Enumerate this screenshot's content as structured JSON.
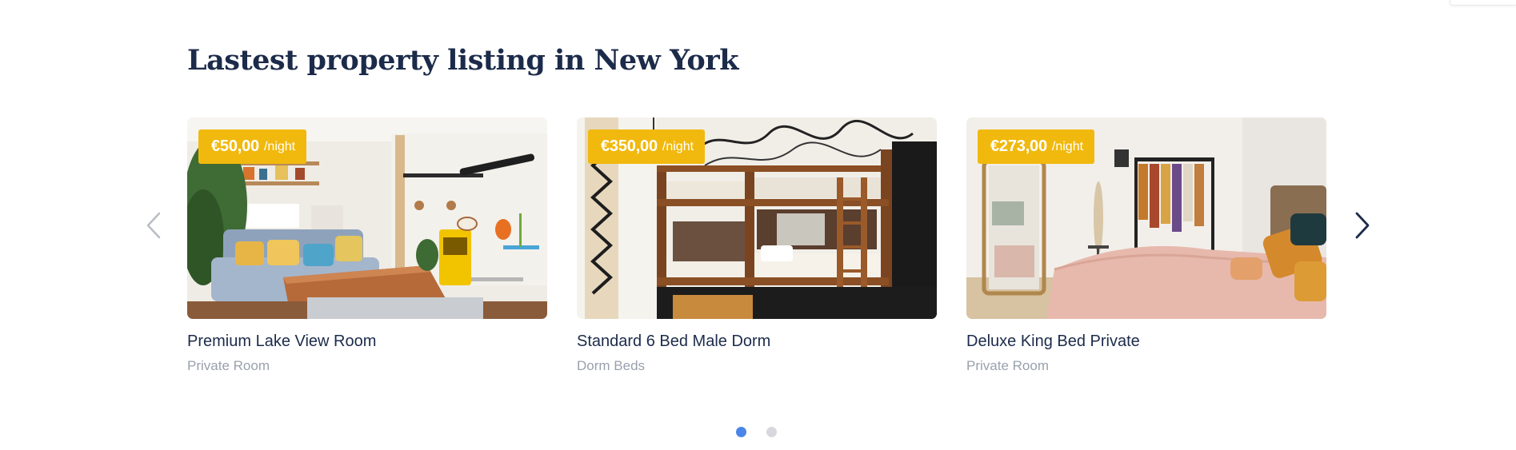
{
  "section": {
    "title": "Lastest property listing in New York"
  },
  "carousel": {
    "prev_icon": "chevron-left-icon",
    "next_icon": "chevron-right-icon",
    "listings": [
      {
        "price": "€50,00",
        "price_unit": "/night",
        "title": "Premium Lake View Room",
        "type": "Private Room",
        "image": "living-room-photo"
      },
      {
        "price": "€350,00",
        "price_unit": "/night",
        "title": "Standard 6 Bed Male Dorm",
        "type": "Dorm Beds",
        "image": "bunk-bed-dorm-photo"
      },
      {
        "price": "€273,00",
        "price_unit": "/night",
        "title": "Deluxe King Bed Private",
        "type": "Private Room",
        "image": "bedroom-photo"
      }
    ],
    "pagination": {
      "pages": 2,
      "active": 1
    }
  },
  "colors": {
    "title": "#1c2b4a",
    "badge": "#f1b90d",
    "subtitle": "#9aa1ad",
    "dot_active": "#4a86e8",
    "dot_inactive": "#d6d8dd"
  }
}
